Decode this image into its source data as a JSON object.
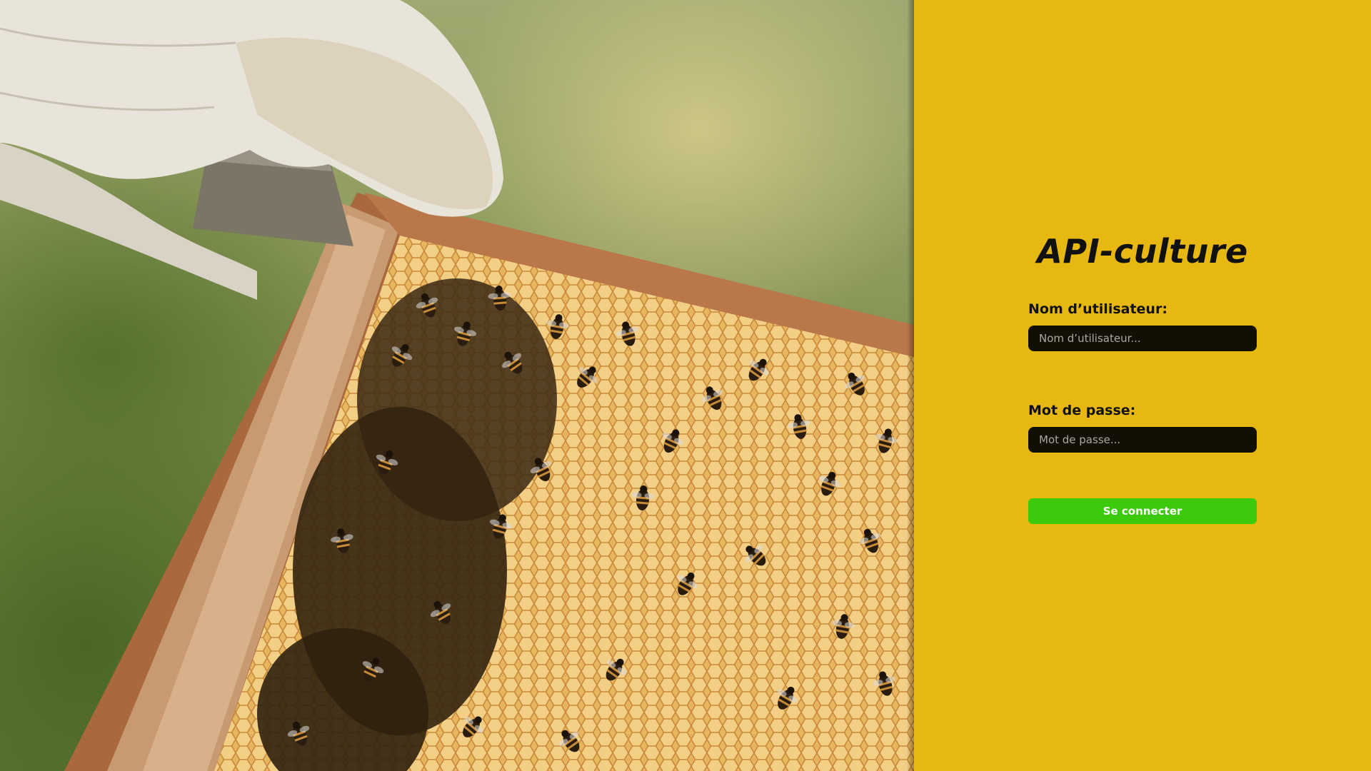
{
  "hero": {
    "image_subject": "beekeeper-gloved-hand-holding-honeycomb-frame-with-bees"
  },
  "login": {
    "title": "API-culture",
    "username": {
      "label": "Nom d’utilisateur:",
      "placeholder": "Nom d’utilisateur...",
      "value": ""
    },
    "password": {
      "label": "Mot de passe:",
      "placeholder": "Mot de passe...",
      "value": ""
    },
    "submit_label": "Se connecter"
  },
  "colors": {
    "panel_background": "#e6b811",
    "input_background": "#120f05",
    "button_background": "#3bcb0c",
    "button_text": "#ffffff",
    "text": "#111111"
  }
}
